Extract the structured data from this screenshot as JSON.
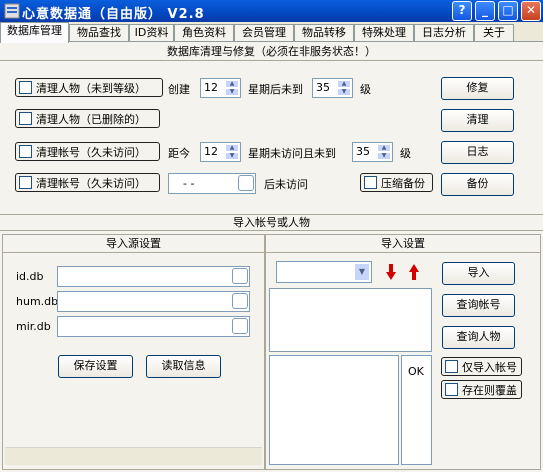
{
  "window": {
    "title": "心意数据通（自由版） V2.8"
  },
  "tabs": [
    "数据库管理",
    "物品查找",
    "ID资料",
    "角色资料",
    "会员管理",
    "物品转移",
    "特殊处理",
    "日志分析",
    "关于"
  ],
  "cleanup": {
    "header": "数据库清理与修复（必须在非服务状态！）",
    "row1_label": "清理人物（未到等级）",
    "row1_create": "创建",
    "row1_weeks": "12",
    "row1_mid": "星期后未到",
    "row1_level": "35",
    "row1_unit": "级",
    "row2_label": "清理人物（已删除的）",
    "row3_label": "清理帐号（久未访问）",
    "row3_from": "距今",
    "row3_weeks": "12",
    "row3_mid": "星期未访问且未到",
    "row3_level": "35",
    "row3_unit": "级",
    "row4_label": "清理帐号（久未访问）",
    "row4_date": "- -",
    "row4_after": "后未访问",
    "compress_label": "压缩备份",
    "btn_repair": "修复",
    "btn_clean": "清理",
    "btn_log": "日志",
    "btn_backup": "备份"
  },
  "import_section": {
    "header": "导入帐号或人物",
    "source": {
      "title": "导入源设置",
      "file1": "id.db",
      "file2": "hum.db",
      "file3": "mir.db",
      "save_label": "保存设置",
      "read_label": "读取信息"
    },
    "settings": {
      "title": "导入设置",
      "import_label": "导入",
      "query_account_label": "查询帐号",
      "query_char_label": "查询人物",
      "only_account_label": "仅导入帐号",
      "overwrite_label": "存在则覆盖",
      "ok_label": "OK"
    }
  },
  "colors": {
    "title_blue": "#0a5fdc",
    "arrow_red": "#d40000"
  }
}
